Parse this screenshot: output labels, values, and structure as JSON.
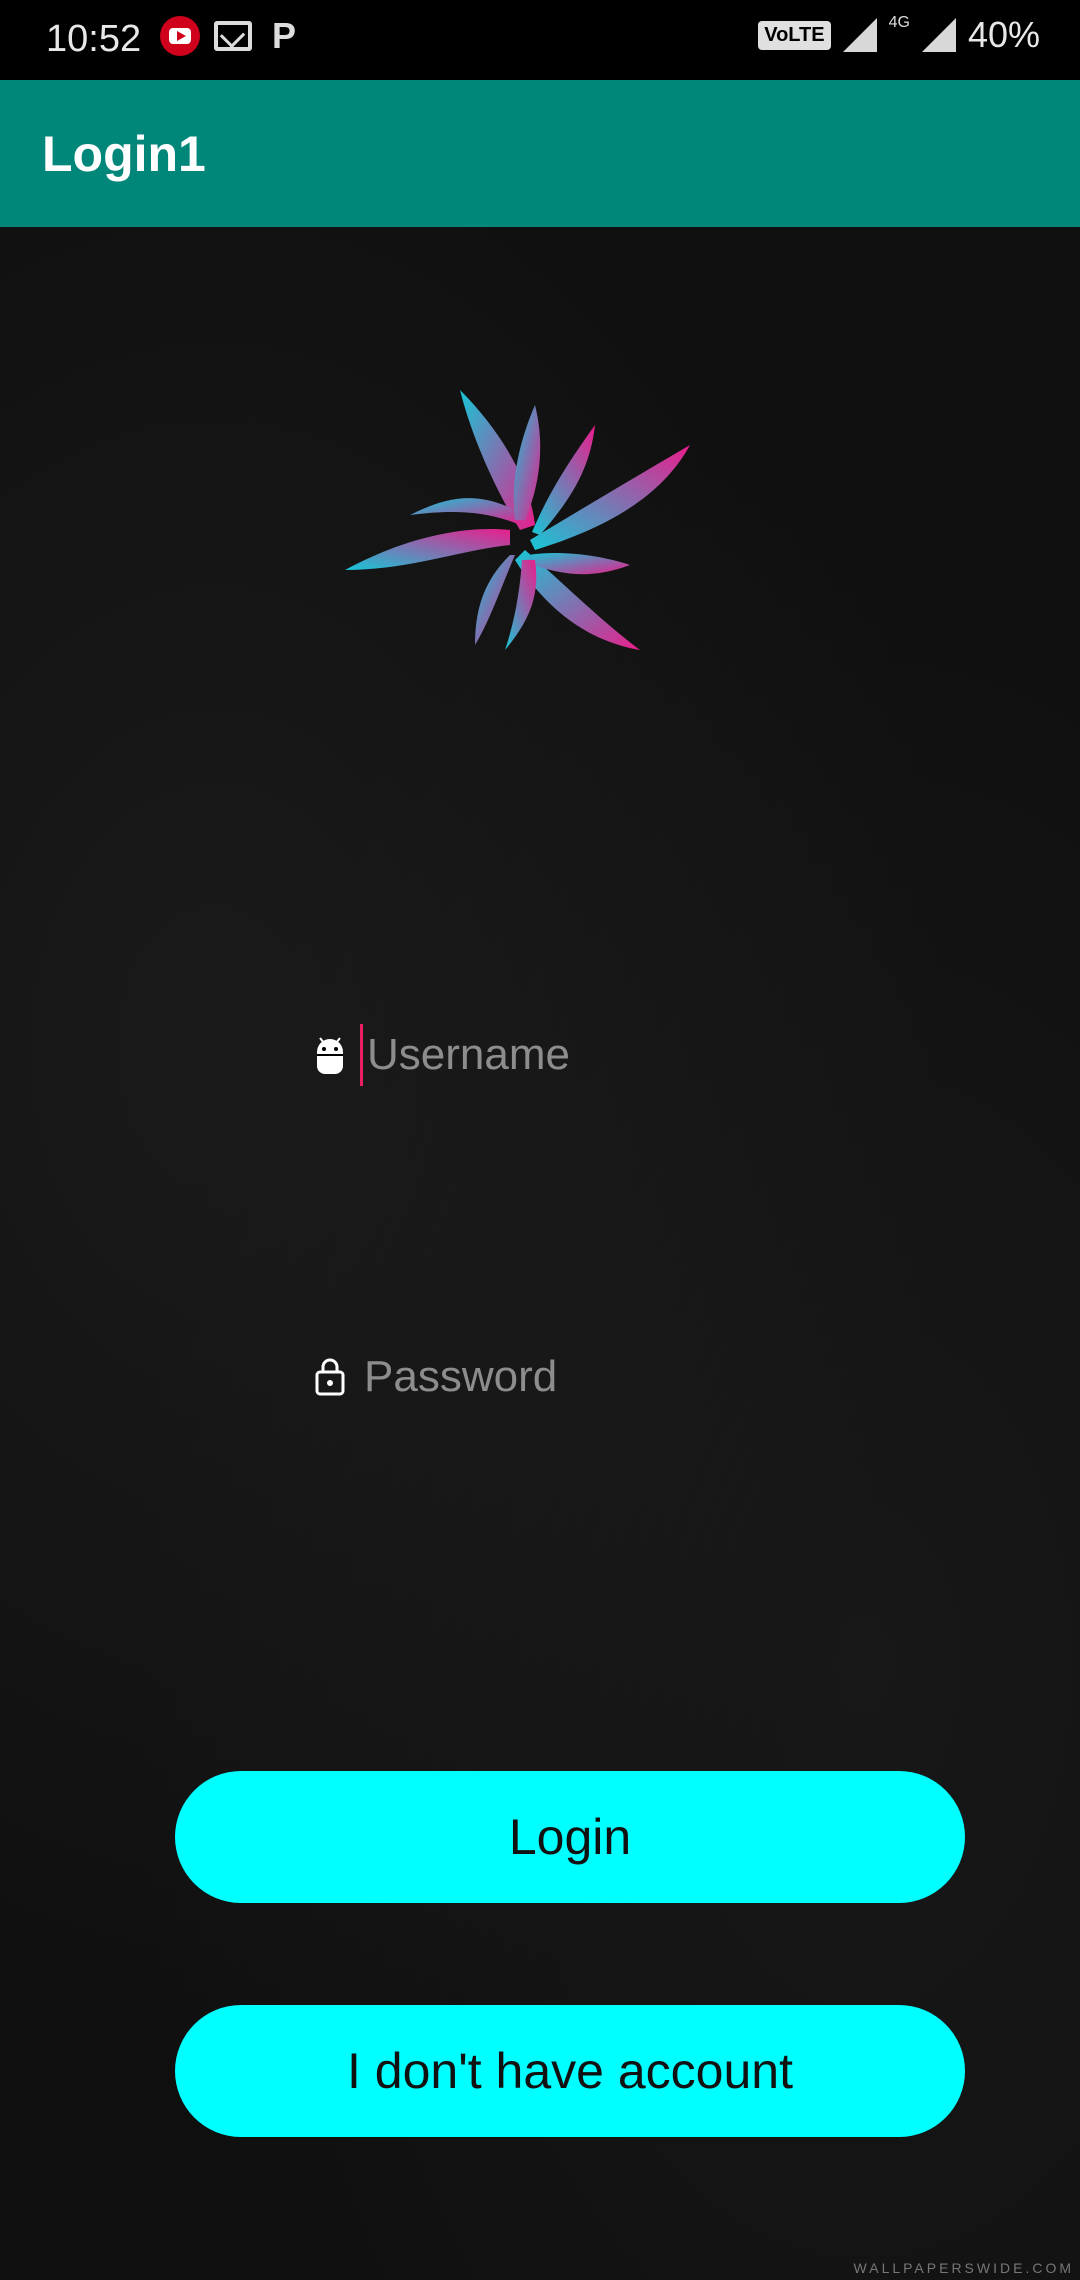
{
  "status": {
    "time": "10:52",
    "volte": "VoLTE",
    "network": "4G",
    "battery": "40%"
  },
  "appbar": {
    "title": "Login1"
  },
  "form": {
    "username_placeholder": "Username",
    "password_placeholder": "Password"
  },
  "buttons": {
    "login": "Login",
    "signup": "I don't have account"
  },
  "watermark": "WALLPAPERSWIDE.COM",
  "colors": {
    "appbar": "#00877A",
    "button": "#00FFFF",
    "cursor": "#E91E63",
    "logo_pink": "#E91E8C",
    "logo_cyan": "#17C6D6"
  },
  "icons": {
    "status": [
      "youtube-icon",
      "mail-icon",
      "paytm-icon",
      "signal-icon"
    ],
    "username": "android-icon",
    "password": "lock-icon"
  }
}
